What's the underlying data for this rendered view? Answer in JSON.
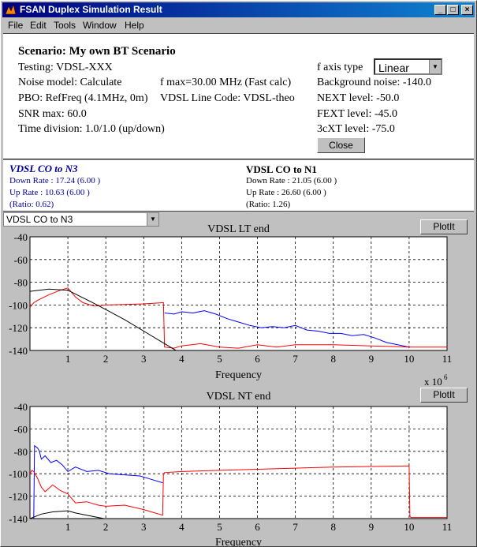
{
  "window": {
    "title": "FSAN Duplex Simulation Result"
  },
  "menu": {
    "items": [
      "File",
      "Edit",
      "Tools",
      "Window",
      "Help"
    ]
  },
  "scenario": {
    "title": "Scenario: My own BT Scenario",
    "testing": "Testing: VDSL-XXX",
    "noise_model": "Noise model: Calculate",
    "fmax": "f max=30.00 MHz (Fast calc)",
    "pbo": "PBO: RefFreq (4.1MHz, 0m)",
    "line_code": "VDSL Line Code: VDSL-theo",
    "snr": "SNR max: 60.0",
    "time_division": "Time division: 1.0/1.0 (up/down)",
    "faxis_label": "f axis type",
    "faxis_value": "Linear",
    "background_noise": "Background noise: -140.0",
    "next_level": "NEXT level: -50.0",
    "fext_level": "FEXT level: -45.0",
    "xt_level": "3cXT level: -75.0",
    "close_label": "Close"
  },
  "rates": {
    "left": {
      "title": "VDSL CO to N3",
      "down": "Down Rate : 17.24 (6.00 )",
      "up": "Up Rate : 10.63 (6.00 )",
      "ratio": "(Ratio: 0.62)"
    },
    "right": {
      "title": "VDSL CO to N1",
      "down": "Down Rate : 21.05 (6.00 )",
      "up": "Up Rate : 26.60 (6.00 )",
      "ratio": "(Ratio: 1.26)"
    }
  },
  "scenario_select": {
    "value": "VDSL CO to N3"
  },
  "plotit_label": "PlotIt",
  "colors": {
    "blue": "#0000ff",
    "red": "#ff0000",
    "black": "#000000",
    "title_blue": "#0000a0"
  },
  "chart_data": [
    {
      "type": "line",
      "title": "VDSL LT end",
      "xlabel": "Frequency",
      "x_exponent": "x 10",
      "x_exponent_power": "6",
      "xlim": [
        0,
        11
      ],
      "ylim": [
        -140,
        -40
      ],
      "xticks": [
        1,
        2,
        3,
        4,
        5,
        6,
        7,
        8,
        9,
        10,
        11
      ],
      "yticks": [
        -40,
        -60,
        -80,
        -100,
        -120,
        -140
      ],
      "grid": true,
      "series": [
        {
          "color": "blue",
          "x": [
            3.55,
            3.8,
            4.0,
            4.3,
            4.6,
            4.9,
            5.2,
            5.5,
            5.8,
            6.1,
            6.4,
            6.7,
            7.0,
            7.3,
            7.6,
            7.9,
            8.2,
            8.5,
            8.8,
            9.1,
            9.4,
            9.7,
            10.0
          ],
          "y": [
            -107,
            -108,
            -106,
            -107,
            -105,
            -108,
            -112,
            -115,
            -118,
            -120,
            -119,
            -120,
            -118,
            -122,
            -123,
            -125,
            -125,
            -127,
            -126,
            -129,
            -133,
            -135,
            -137
          ]
        },
        {
          "color": "red",
          "x": [
            0.0,
            0.1,
            0.2,
            0.5,
            0.8,
            1.0,
            1.2,
            1.4,
            1.7,
            2.0,
            2.5,
            3.0,
            3.5,
            3.52,
            3.55,
            3.8,
            4.0,
            4.5,
            5.0,
            5.5,
            6.0,
            6.5,
            7.0,
            8.0,
            9.0,
            10.0,
            11.0
          ],
          "y": [
            -102,
            -98,
            -96,
            -91,
            -87,
            -85,
            -93,
            -98,
            -101,
            -100,
            -99.5,
            -99,
            -98,
            -98,
            -137,
            -138,
            -136,
            -134,
            -137,
            -138,
            -135,
            -137,
            -135,
            -135,
            -136,
            -137,
            -137
          ]
        },
        {
          "color": "black",
          "x": [
            0.0,
            0.5,
            1.0,
            1.3,
            1.6,
            2.0,
            2.5,
            3.0,
            3.5,
            3.9
          ],
          "y": [
            -88,
            -86,
            -87,
            -92,
            -97,
            -104,
            -113,
            -123,
            -133,
            -141
          ]
        }
      ]
    },
    {
      "type": "line",
      "title": "VDSL NT end",
      "xlabel": "Frequency",
      "xlim": [
        0,
        11
      ],
      "ylim": [
        -140,
        -40
      ],
      "xticks": [
        1,
        2,
        3,
        4,
        5,
        6,
        7,
        8,
        9,
        10,
        11
      ],
      "yticks": [
        -40,
        -60,
        -80,
        -100,
        -120,
        -140
      ],
      "grid": true,
      "series": [
        {
          "color": "blue",
          "x": [
            0.1,
            0.12,
            0.2,
            0.25,
            0.3,
            0.4,
            0.55,
            0.7,
            0.85,
            1.0,
            1.2,
            1.5,
            1.8,
            2.1,
            2.5,
            2.9,
            3.2,
            3.5
          ],
          "y": [
            -140,
            -75,
            -77,
            -80,
            -87,
            -84,
            -90,
            -88,
            -92,
            -98,
            -94,
            -98,
            -97,
            -100,
            -101,
            -102,
            -105,
            -108
          ]
        },
        {
          "color": "red",
          "x": [
            0.0,
            0.05,
            0.1,
            0.2,
            0.3,
            0.4,
            0.6,
            0.8,
            1.0,
            1.2,
            1.5,
            1.8,
            2.0,
            2.5,
            3.0,
            3.5,
            3.52,
            3.55,
            4.0,
            5.0,
            6.0,
            7.0,
            8.0,
            9.0,
            10.0,
            10.02,
            10.05,
            11.0
          ],
          "y": [
            -100,
            -97,
            -98,
            -104,
            -112,
            -116,
            -110,
            -115,
            -118,
            -126,
            -125,
            -128,
            -129,
            -128,
            -132,
            -137,
            -100,
            -99,
            -98,
            -97,
            -96,
            -95,
            -94,
            -93.5,
            -93,
            -138,
            -139,
            -139
          ]
        },
        {
          "color": "black",
          "x": [
            0.0,
            0.3,
            0.6,
            1.0,
            1.2,
            1.5,
            1.8,
            2.1
          ],
          "y": [
            -140,
            -136,
            -134,
            -133,
            -135,
            -137,
            -139,
            -141
          ]
        }
      ]
    }
  ]
}
